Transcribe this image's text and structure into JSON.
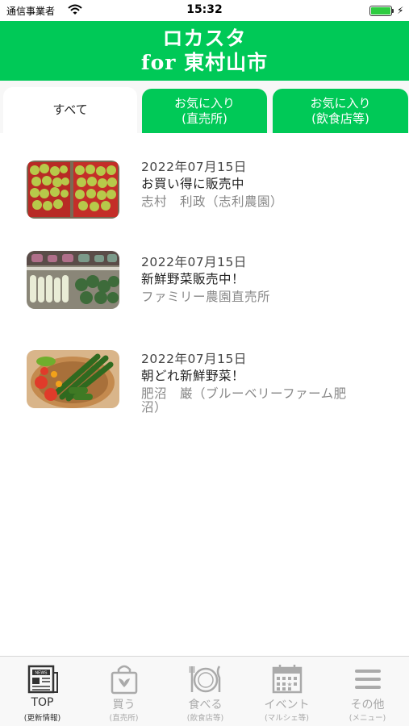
{
  "status_bar": {
    "carrier": "通信事業者",
    "time": "15:32"
  },
  "header": {
    "title_line1": "ロカスタ",
    "title_line2": "for 東村山市"
  },
  "tabs": [
    {
      "label": "すべて"
    },
    {
      "label_line1": "お気に入り",
      "label_line2": "(直売所)"
    },
    {
      "label_line1": "お気に入り",
      "label_line2": "(飲食店等)"
    }
  ],
  "news": [
    {
      "date": "2022年07月15日",
      "title": "お買い得に販売中",
      "author": "志村　利政（志利農園）"
    },
    {
      "date": "2022年07月15日",
      "title": "新鮮野菜販売中！",
      "author": "ファミリー農園直売所"
    },
    {
      "date": "2022年07月15日",
      "title": "朝どれ新鮮野菜！",
      "author_line1": "肥沼　巌（ブルーベリーファーム肥",
      "author_line2": "沼）"
    }
  ],
  "tab_bar": [
    {
      "label": "TOP",
      "sub": "(更新情報)",
      "icon": "newspaper-icon"
    },
    {
      "label": "買う",
      "sub": "(直売所)",
      "icon": "shopping-bag-icon"
    },
    {
      "label": "食べる",
      "sub": "(飲食店等)",
      "icon": "plate-cutlery-icon"
    },
    {
      "label": "イベント",
      "sub": "(マルシェ等)",
      "icon": "calendar-icon"
    },
    {
      "label": "その他",
      "sub": "(メニュー)",
      "icon": "menu-icon"
    }
  ],
  "colors": {
    "brand_green": "#00c957",
    "active_tab": "#333333",
    "inactive_tab": "#a9a9a9"
  }
}
